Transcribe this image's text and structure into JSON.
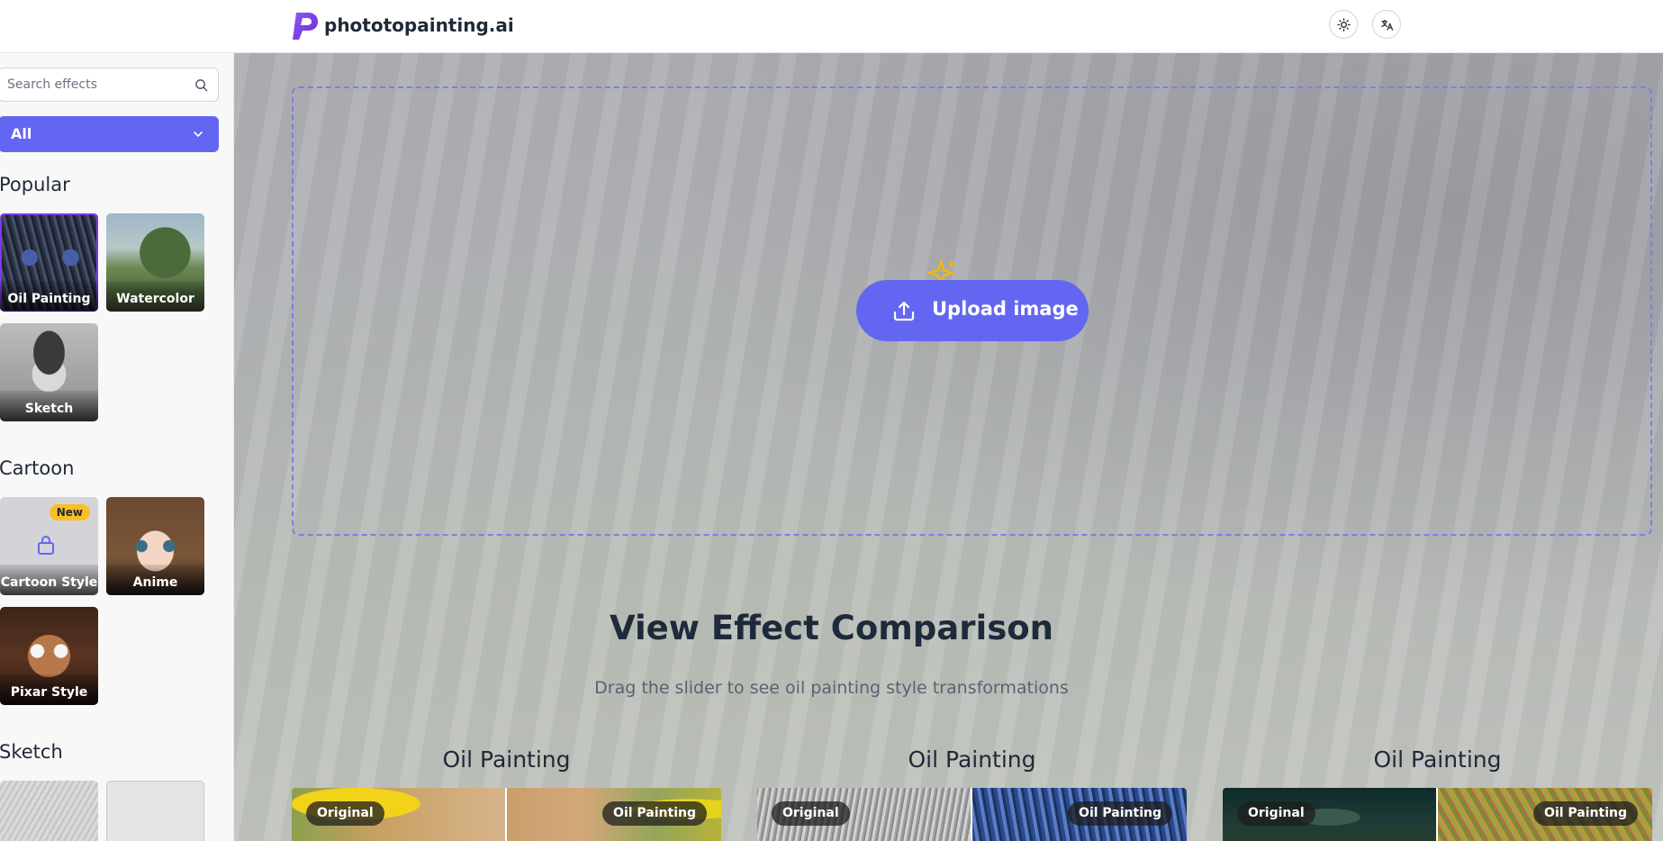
{
  "header": {
    "logo_text": "phototopainting.ai",
    "theme_toggle_icon": "sun-icon",
    "language_icon": "translate-icon"
  },
  "sidebar": {
    "search_placeholder": "Search effects",
    "category_select": "All",
    "sections": [
      {
        "title": "Popular",
        "cards": [
          "Oil Painting",
          "Watercolor",
          "Sketch"
        ]
      },
      {
        "title": "Cartoon",
        "cards": [
          "Cartoon Style",
          "Anime",
          "Pixar Style"
        ]
      },
      {
        "title": "Sketch",
        "cards": []
      }
    ],
    "new_badge": "New"
  },
  "main": {
    "upload_label": "Upload image",
    "comparison_title": "View Effect Comparison",
    "comparison_subtitle": "Drag the slider to see oil painting style transformations",
    "comparisons": [
      {
        "title": "Oil Painting",
        "left_label": "Original",
        "right_label": "Oil Painting"
      },
      {
        "title": "Oil Painting",
        "left_label": "Original",
        "right_label": "Oil Painting"
      },
      {
        "title": "Oil Painting",
        "left_label": "Original",
        "right_label": "Oil Painting"
      }
    ]
  },
  "colors": {
    "accent": "#6366f1",
    "selected_outline": "#7c3aed",
    "new_badge": "#fbbf24"
  }
}
